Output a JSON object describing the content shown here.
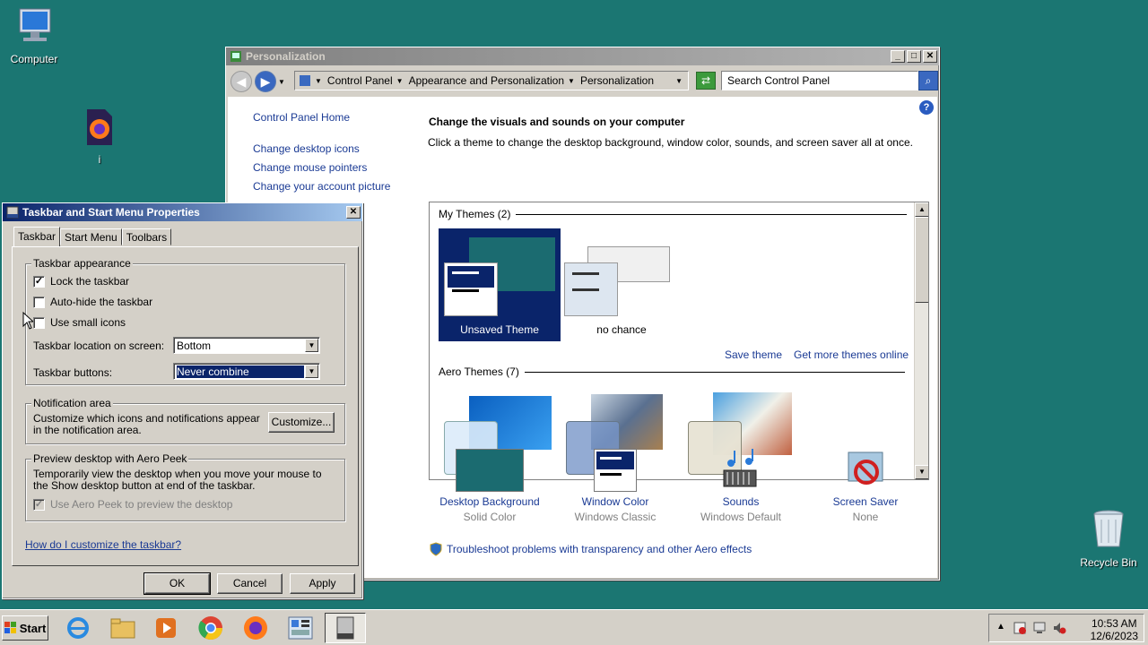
{
  "desktop": {
    "icons": [
      {
        "label": "Computer"
      },
      {
        "label": "i"
      },
      {
        "label": "Recycle Bin"
      }
    ]
  },
  "personalization": {
    "title": "Personalization",
    "address": [
      "Control Panel",
      "Appearance and Personalization",
      "Personalization"
    ],
    "search_placeholder": "Search Control Panel",
    "side_links": [
      "Control Panel Home",
      "Change desktop icons",
      "Change mouse pointers",
      "Change your account picture"
    ],
    "heading": "Change the visuals and sounds on your computer",
    "subheading": "Click a theme to change the desktop background, window color, sounds, and screen saver all at once.",
    "my_themes_label": "My Themes (2)",
    "themes": [
      {
        "name": "Unsaved Theme",
        "selected": true
      },
      {
        "name": "no chance",
        "selected": false
      }
    ],
    "save_theme": "Save theme",
    "get_more": "Get more themes online",
    "aero_label": "Aero Themes (7)",
    "options": [
      {
        "title": "Desktop Background",
        "sub": "Solid Color"
      },
      {
        "title": "Window Color",
        "sub": "Windows Classic"
      },
      {
        "title": "Sounds",
        "sub": "Windows Default"
      },
      {
        "title": "Screen Saver",
        "sub": "None"
      }
    ],
    "troubleshoot": "Troubleshoot problems with transparency and other Aero effects"
  },
  "taskbar_props": {
    "title": "Taskbar and Start Menu Properties",
    "tabs": [
      "Taskbar",
      "Start Menu",
      "Toolbars"
    ],
    "appearance_group": "Taskbar appearance",
    "lock": {
      "label": "Lock the taskbar",
      "checked": true
    },
    "autohide": {
      "label": "Auto-hide the taskbar",
      "checked": false
    },
    "small_icons": {
      "label": "Use small icons",
      "checked": false
    },
    "location_label": "Taskbar location on screen:",
    "location_value": "Bottom",
    "buttons_label": "Taskbar buttons:",
    "buttons_value": "Never combine",
    "notif_group": "Notification area",
    "notif_text": "Customize which icons and notifications appear in the notification area.",
    "customize_btn": "Customize...",
    "peek_group": "Preview desktop with Aero Peek",
    "peek_text": "Temporarily view the desktop when you move your mouse to the Show desktop button at end of the taskbar.",
    "peek_cb": {
      "label": "Use Aero Peek to preview the desktop",
      "checked": true
    },
    "help_link": "How do I customize the taskbar?",
    "ok": "OK",
    "cancel": "Cancel",
    "apply": "Apply"
  },
  "taskbar": {
    "start": "Start",
    "time": "10:53 AM",
    "date": "12/6/2023"
  },
  "colors": {
    "desktop": "#1b7672",
    "selection": "#0a246a",
    "link": "#1a3a94"
  }
}
